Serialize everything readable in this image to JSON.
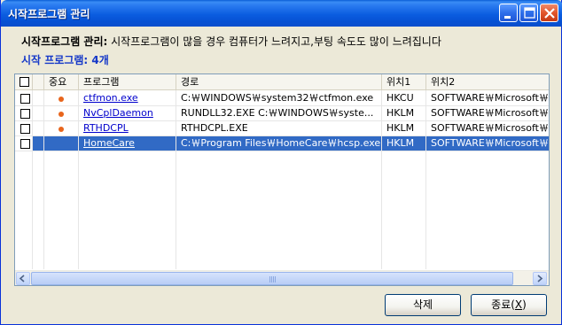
{
  "window": {
    "title": "시작프로그램 관리"
  },
  "description": {
    "bold": "시작프로그램 관리:",
    "text": " 시작프로그램이 많을 경우 컴퓨터가 느려지고,부팅 속도도 많이 느려집니다"
  },
  "count_label": "시작 프로그램: 4개",
  "table": {
    "columns": [
      "",
      "중요",
      "프로그램",
      "경로",
      "위치1",
      "위치2"
    ],
    "rows": [
      {
        "program": "ctfmon.exe",
        "path": "C:￦WINDOWS￦system32￦ctfmon.exe",
        "loc1": "HKCU",
        "loc2": "SOFTWARE￦Microsoft￦",
        "important": true,
        "selected": false
      },
      {
        "program": "NvCplDaemon",
        "path": "RUNDLL32.EXE C:￦WINDOWS￦syste...",
        "loc1": "HKLM",
        "loc2": "SOFTWARE￦Microsoft￦",
        "important": true,
        "selected": false
      },
      {
        "program": "RTHDCPL",
        "path": "RTHDCPL.EXE",
        "loc1": "HKLM",
        "loc2": "SOFTWARE￦Microsoft￦",
        "important": true,
        "selected": false
      },
      {
        "program": "HomeCare",
        "path": "C:￦Program Files￦HomeCare￦hcsp.exe",
        "loc1": "HKLM",
        "loc2": "SOFTWARE￦Microsoft￦",
        "important": false,
        "selected": true
      }
    ]
  },
  "buttons": {
    "delete": "삭제",
    "exit_prefix": "종료(",
    "exit_key": "X",
    "exit_suffix": ")"
  },
  "colors": {
    "titlebar": "#0A5DD6",
    "selection": "#316AC5",
    "count_text": "#1538C8",
    "important_dot": "#E8651C",
    "link": "#0000CC"
  },
  "icons": [
    "minimize-icon",
    "maximize-icon",
    "close-icon",
    "scroll-left-icon",
    "scroll-right-icon",
    "checkbox-icon",
    "important-dot-icon"
  ]
}
